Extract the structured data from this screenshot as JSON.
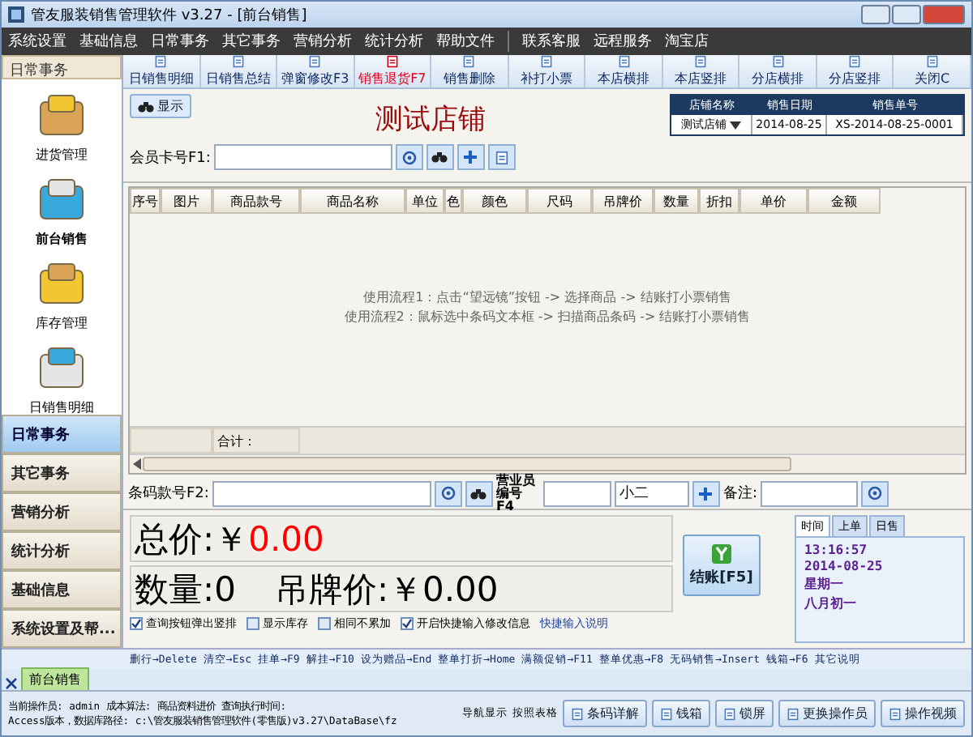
{
  "window": {
    "title": "管友服装销售管理软件 v3.27 - [前台销售]"
  },
  "menu": [
    "系统设置",
    "基础信息",
    "日常事务",
    "其它事务",
    "营销分析",
    "统计分析",
    "帮助文件"
  ],
  "menu_extra": [
    "联系客服",
    "远程服务",
    "淘宝店"
  ],
  "sidebar": {
    "header": "日常事务",
    "modules": [
      "进货管理",
      "前台销售",
      "库存管理",
      "日销售明细"
    ],
    "nav": [
      {
        "label": "日常事务",
        "selected": true
      },
      {
        "label": "其它事务",
        "selected": false
      },
      {
        "label": "营销分析",
        "selected": false
      },
      {
        "label": "统计分析",
        "selected": false
      },
      {
        "label": "基础信息",
        "selected": false
      },
      {
        "label": "系统设置及帮...",
        "selected": false
      }
    ]
  },
  "toolbar": [
    {
      "label": "日销售明细",
      "emphasis": false
    },
    {
      "label": "日销售总结",
      "emphasis": false
    },
    {
      "label": "弹窗修改F3",
      "emphasis": false
    },
    {
      "label": "销售退货F7",
      "emphasis": true
    },
    {
      "label": "销售删除",
      "emphasis": false
    },
    {
      "label": "补打小票",
      "emphasis": false
    },
    {
      "label": "本店横排",
      "emphasis": false
    },
    {
      "label": "本店竖排",
      "emphasis": false
    },
    {
      "label": "分店横排",
      "emphasis": false
    },
    {
      "label": "分店竖排",
      "emphasis": false
    },
    {
      "label": "关闭C",
      "emphasis": false
    }
  ],
  "show_button": "显示",
  "store_title": "测试店铺",
  "info": {
    "columns": [
      "店铺名称",
      "销售日期",
      "销售单号"
    ],
    "store": "测试店铺",
    "date": "2014-08-25",
    "number": "XS-2014-08-25-0001"
  },
  "member": {
    "label": "会员卡号F1:"
  },
  "table": {
    "columns": [
      "序号",
      "图片",
      "商品款号",
      "商品名称",
      "单位",
      "色",
      "颜色",
      "尺码",
      "吊牌价",
      "数量",
      "折扣",
      "单价",
      "金额"
    ],
    "hints": [
      "使用流程1：点击“望远镜”按钮 -> 选择商品 -> 结账打小票销售",
      "使用流程2：鼠标选中条码文本框 -> 扫描商品条码 -> 结账打小票销售"
    ],
    "total_label": "合计："
  },
  "barcode": {
    "label": "条码款号F2:",
    "staff_label": "营业员编号F4",
    "staff_value": "小二",
    "note_label": "备注:"
  },
  "totals": {
    "total_label": "总价:￥",
    "total_value": "0.00",
    "qty": "数量:0",
    "tag_price": "吊牌价:￥0.00",
    "checkout": "结账[F5]"
  },
  "options": [
    {
      "label": "查询按钮弹出竖排",
      "checked": true
    },
    {
      "label": "显示库存",
      "checked": false
    },
    {
      "label": "相同不累加",
      "checked": false
    },
    {
      "label": "开启快捷输入修改信息",
      "checked": true
    }
  ],
  "options_link": "快捷输入说明",
  "clock": {
    "tabs": [
      {
        "label": "时间",
        "selected": true
      },
      {
        "label": "上单",
        "selected": false
      },
      {
        "label": "日售",
        "selected": false
      }
    ],
    "lines": [
      "13:16:57",
      "2014-08-25",
      "星期一",
      "八月初一"
    ]
  },
  "shortcuts": [
    "删行→Delete",
    "清空→Esc",
    "挂单→F9",
    "解挂→F10",
    "设为赠品→End",
    "整单打折→Home",
    "满额促销→F11",
    "整单优惠→F8",
    "无码销售→Insert",
    "钱箱→F6",
    "其它说明"
  ],
  "doc_tab": "前台销售",
  "status": {
    "line1": "当前操作员: admin  成本算法: 商品资料进价  查询执行时间:",
    "line2": "Access版本，数据库路径: c:\\管友服装销售管理软件(零售版)v3.27\\DataBase\\fz",
    "nav_label": "导航显示",
    "grid_label": "按照表格",
    "buttons": [
      "条码详解",
      "钱箱",
      "锁屏",
      "更换操作员",
      "操作视频"
    ]
  }
}
